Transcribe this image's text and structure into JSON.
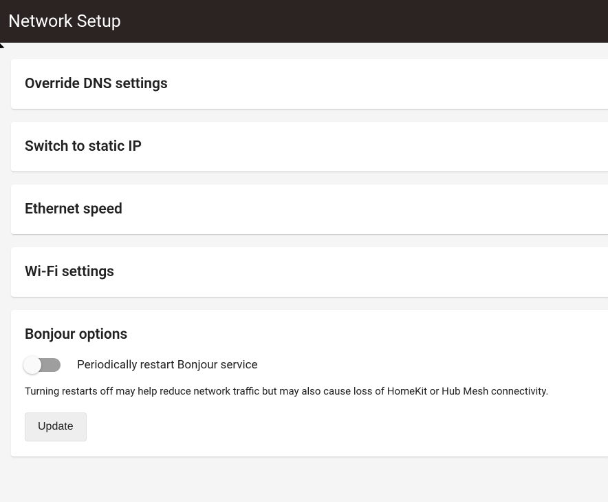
{
  "header": {
    "title": "Network Setup"
  },
  "sections": {
    "override_dns": {
      "title": "Override DNS settings"
    },
    "static_ip": {
      "title": "Switch to static IP"
    },
    "ethernet_speed": {
      "title": "Ethernet speed"
    },
    "wifi": {
      "title": "Wi-Fi settings"
    },
    "bonjour": {
      "title": "Bonjour options",
      "toggle_label": "Periodically restart Bonjour service",
      "toggle_state": false,
      "help_text": "Turning restarts off may help reduce network traffic but may also cause loss of HomeKit or Hub Mesh connectivity.",
      "update_button": "Update"
    }
  }
}
